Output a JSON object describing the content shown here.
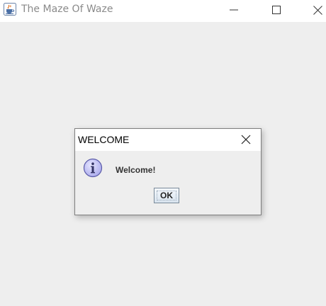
{
  "window": {
    "title": "The Maze Of Waze"
  },
  "dialog": {
    "title": "WELCOME",
    "message": "Welcome!",
    "ok_label": "OK"
  },
  "icons": {
    "app": "java-cup-icon",
    "info": "information-icon",
    "minimize": "minimize-icon",
    "maximize": "maximize-icon",
    "close": "close-icon"
  },
  "colors": {
    "window_background": "#eeeeee",
    "titlebar_background": "#ffffff",
    "title_text": "#8a8a8a",
    "info_icon": "#b9b9f0"
  }
}
